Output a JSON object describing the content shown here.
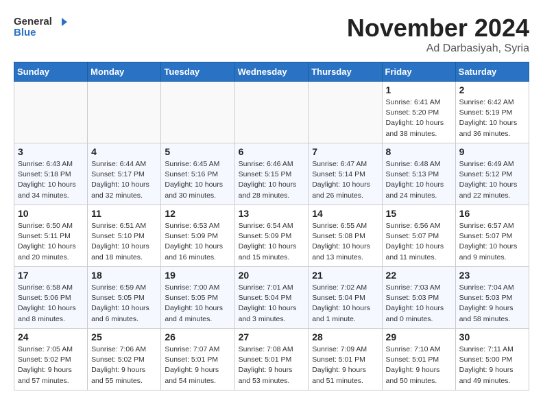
{
  "logo": {
    "line1": "General",
    "line2": "Blue"
  },
  "title": "November 2024",
  "location": "Ad Darbasiyah, Syria",
  "days_of_week": [
    "Sunday",
    "Monday",
    "Tuesday",
    "Wednesday",
    "Thursday",
    "Friday",
    "Saturday"
  ],
  "weeks": [
    [
      {
        "num": "",
        "sunrise": "",
        "sunset": "",
        "daylight": ""
      },
      {
        "num": "",
        "sunrise": "",
        "sunset": "",
        "daylight": ""
      },
      {
        "num": "",
        "sunrise": "",
        "sunset": "",
        "daylight": ""
      },
      {
        "num": "",
        "sunrise": "",
        "sunset": "",
        "daylight": ""
      },
      {
        "num": "",
        "sunrise": "",
        "sunset": "",
        "daylight": ""
      },
      {
        "num": "1",
        "sunrise": "Sunrise: 6:41 AM",
        "sunset": "Sunset: 5:20 PM",
        "daylight": "Daylight: 10 hours and 38 minutes."
      },
      {
        "num": "2",
        "sunrise": "Sunrise: 6:42 AM",
        "sunset": "Sunset: 5:19 PM",
        "daylight": "Daylight: 10 hours and 36 minutes."
      }
    ],
    [
      {
        "num": "3",
        "sunrise": "Sunrise: 6:43 AM",
        "sunset": "Sunset: 5:18 PM",
        "daylight": "Daylight: 10 hours and 34 minutes."
      },
      {
        "num": "4",
        "sunrise": "Sunrise: 6:44 AM",
        "sunset": "Sunset: 5:17 PM",
        "daylight": "Daylight: 10 hours and 32 minutes."
      },
      {
        "num": "5",
        "sunrise": "Sunrise: 6:45 AM",
        "sunset": "Sunset: 5:16 PM",
        "daylight": "Daylight: 10 hours and 30 minutes."
      },
      {
        "num": "6",
        "sunrise": "Sunrise: 6:46 AM",
        "sunset": "Sunset: 5:15 PM",
        "daylight": "Daylight: 10 hours and 28 minutes."
      },
      {
        "num": "7",
        "sunrise": "Sunrise: 6:47 AM",
        "sunset": "Sunset: 5:14 PM",
        "daylight": "Daylight: 10 hours and 26 minutes."
      },
      {
        "num": "8",
        "sunrise": "Sunrise: 6:48 AM",
        "sunset": "Sunset: 5:13 PM",
        "daylight": "Daylight: 10 hours and 24 minutes."
      },
      {
        "num": "9",
        "sunrise": "Sunrise: 6:49 AM",
        "sunset": "Sunset: 5:12 PM",
        "daylight": "Daylight: 10 hours and 22 minutes."
      }
    ],
    [
      {
        "num": "10",
        "sunrise": "Sunrise: 6:50 AM",
        "sunset": "Sunset: 5:11 PM",
        "daylight": "Daylight: 10 hours and 20 minutes."
      },
      {
        "num": "11",
        "sunrise": "Sunrise: 6:51 AM",
        "sunset": "Sunset: 5:10 PM",
        "daylight": "Daylight: 10 hours and 18 minutes."
      },
      {
        "num": "12",
        "sunrise": "Sunrise: 6:53 AM",
        "sunset": "Sunset: 5:09 PM",
        "daylight": "Daylight: 10 hours and 16 minutes."
      },
      {
        "num": "13",
        "sunrise": "Sunrise: 6:54 AM",
        "sunset": "Sunset: 5:09 PM",
        "daylight": "Daylight: 10 hours and 15 minutes."
      },
      {
        "num": "14",
        "sunrise": "Sunrise: 6:55 AM",
        "sunset": "Sunset: 5:08 PM",
        "daylight": "Daylight: 10 hours and 13 minutes."
      },
      {
        "num": "15",
        "sunrise": "Sunrise: 6:56 AM",
        "sunset": "Sunset: 5:07 PM",
        "daylight": "Daylight: 10 hours and 11 minutes."
      },
      {
        "num": "16",
        "sunrise": "Sunrise: 6:57 AM",
        "sunset": "Sunset: 5:07 PM",
        "daylight": "Daylight: 10 hours and 9 minutes."
      }
    ],
    [
      {
        "num": "17",
        "sunrise": "Sunrise: 6:58 AM",
        "sunset": "Sunset: 5:06 PM",
        "daylight": "Daylight: 10 hours and 8 minutes."
      },
      {
        "num": "18",
        "sunrise": "Sunrise: 6:59 AM",
        "sunset": "Sunset: 5:05 PM",
        "daylight": "Daylight: 10 hours and 6 minutes."
      },
      {
        "num": "19",
        "sunrise": "Sunrise: 7:00 AM",
        "sunset": "Sunset: 5:05 PM",
        "daylight": "Daylight: 10 hours and 4 minutes."
      },
      {
        "num": "20",
        "sunrise": "Sunrise: 7:01 AM",
        "sunset": "Sunset: 5:04 PM",
        "daylight": "Daylight: 10 hours and 3 minutes."
      },
      {
        "num": "21",
        "sunrise": "Sunrise: 7:02 AM",
        "sunset": "Sunset: 5:04 PM",
        "daylight": "Daylight: 10 hours and 1 minute."
      },
      {
        "num": "22",
        "sunrise": "Sunrise: 7:03 AM",
        "sunset": "Sunset: 5:03 PM",
        "daylight": "Daylight: 10 hours and 0 minutes."
      },
      {
        "num": "23",
        "sunrise": "Sunrise: 7:04 AM",
        "sunset": "Sunset: 5:03 PM",
        "daylight": "Daylight: 9 hours and 58 minutes."
      }
    ],
    [
      {
        "num": "24",
        "sunrise": "Sunrise: 7:05 AM",
        "sunset": "Sunset: 5:02 PM",
        "daylight": "Daylight: 9 hours and 57 minutes."
      },
      {
        "num": "25",
        "sunrise": "Sunrise: 7:06 AM",
        "sunset": "Sunset: 5:02 PM",
        "daylight": "Daylight: 9 hours and 55 minutes."
      },
      {
        "num": "26",
        "sunrise": "Sunrise: 7:07 AM",
        "sunset": "Sunset: 5:01 PM",
        "daylight": "Daylight: 9 hours and 54 minutes."
      },
      {
        "num": "27",
        "sunrise": "Sunrise: 7:08 AM",
        "sunset": "Sunset: 5:01 PM",
        "daylight": "Daylight: 9 hours and 53 minutes."
      },
      {
        "num": "28",
        "sunrise": "Sunrise: 7:09 AM",
        "sunset": "Sunset: 5:01 PM",
        "daylight": "Daylight: 9 hours and 51 minutes."
      },
      {
        "num": "29",
        "sunrise": "Sunrise: 7:10 AM",
        "sunset": "Sunset: 5:01 PM",
        "daylight": "Daylight: 9 hours and 50 minutes."
      },
      {
        "num": "30",
        "sunrise": "Sunrise: 7:11 AM",
        "sunset": "Sunset: 5:00 PM",
        "daylight": "Daylight: 9 hours and 49 minutes."
      }
    ]
  ]
}
